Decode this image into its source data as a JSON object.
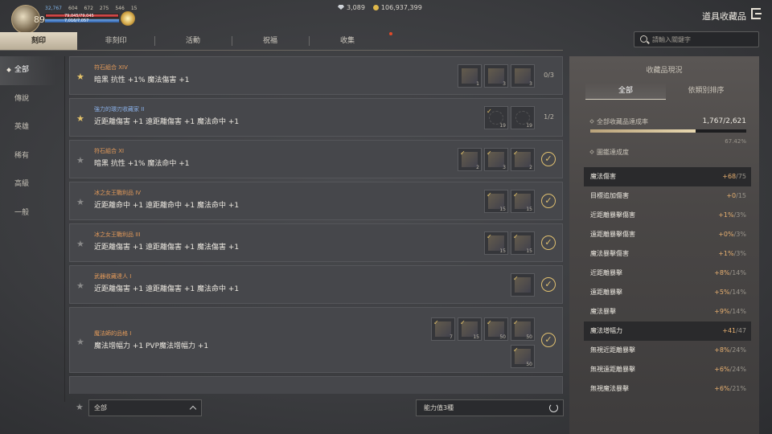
{
  "hud": {
    "level": "89",
    "stat1": "32,767",
    "stat2": "604",
    "stat3": "672",
    "stat4": "275",
    "stat5": "546",
    "stat6": "15",
    "hp": "79,045/79,045",
    "mp": "7,016/7,057"
  },
  "currency": {
    "gems": "3,089",
    "gold": "106,937,399"
  },
  "page_title": "道具收藏品",
  "tabs": [
    "刻印",
    "非刻印",
    "活動",
    "祝福",
    "收集"
  ],
  "search": {
    "placeholder": "請輸入關鍵字"
  },
  "sidebar": [
    "全部",
    "傳說",
    "英雄",
    "稀有",
    "高級",
    "一般"
  ],
  "rows": [
    {
      "category": "符石組合 XIV",
      "effect": "暗黑 抗性 +1% 魔法傷害 +1",
      "progress": "0/3",
      "star": "gold",
      "slots": [
        {
          "count": "1"
        },
        {
          "count": "3"
        },
        {
          "count": "3"
        }
      ]
    },
    {
      "category": "強力的環刃收藏家 II",
      "effect": "近距離傷害 +1 遠距離傷害 +1 魔法命中 +1",
      "progress": "1/2",
      "star": "gold",
      "slots": [
        {
          "count": "19",
          "empty": true,
          "chk": true
        },
        {
          "count": "19",
          "empty": true
        }
      ]
    },
    {
      "category": "符石組合 XI",
      "effect": "暗黑 抗性 +1% 魔法命中 +1",
      "progress": "",
      "star": "grey",
      "done": true,
      "slots": [
        {
          "count": "2",
          "chk": true
        },
        {
          "count": "3",
          "chk": true
        },
        {
          "count": "2",
          "chk": true
        }
      ]
    },
    {
      "category": "冰之女王戰利品 IV",
      "effect": "近距離命中 +1 遠距離命中 +1 魔法命中 +1",
      "progress": "",
      "star": "grey",
      "done": true,
      "slots": [
        {
          "count": "15",
          "chk": true
        },
        {
          "count": "15",
          "chk": true
        }
      ]
    },
    {
      "category": "冰之女王戰利品 III",
      "effect": "近距離傷害 +1 遠距離傷害 +1 魔法傷害 +1",
      "progress": "",
      "star": "grey",
      "done": true,
      "slots": [
        {
          "count": "15",
          "chk": true
        },
        {
          "count": "15",
          "chk": true
        }
      ]
    },
    {
      "category": "武器收藏達人 I",
      "effect": "近距離傷害 +1 遠距離傷害 +1 魔法命中 +1",
      "progress": "",
      "star": "grey",
      "done": true,
      "slots": [
        {
          "count": "",
          "chk": true
        }
      ]
    },
    {
      "category": "魔法師的品格 I",
      "effect": "魔法增幅力 +1 PVP魔法增幅力 +1",
      "progress": "",
      "star": "grey",
      "done": true,
      "slots": [
        {
          "count": "7",
          "chk": true
        },
        {
          "count": "15",
          "chk": true
        },
        {
          "count": "50",
          "chk": true
        },
        {
          "count": "50",
          "chk": true
        }
      ],
      "slots2": [
        {
          "count": "50",
          "chk": true
        }
      ]
    }
  ],
  "bottom": {
    "filter": "全部",
    "sort": "能力值3種"
  },
  "panel": {
    "title": "收藏品現況",
    "tab_all": "全部",
    "tab_sort": "依類別排序",
    "total_label": "全部收藏品達成率",
    "total_value": "1,767/2,621",
    "total_fraction": 0.6742,
    "total_pct": "67.42%",
    "collection_label": "圖鑑達成度",
    "stats": [
      {
        "name": "魔法傷害",
        "cur": "+68",
        "max": "/75",
        "hl": true
      },
      {
        "name": "目標追加傷害",
        "cur": "+0",
        "max": "/15"
      },
      {
        "name": "近距離暴擊傷害",
        "cur": "+1%",
        "max": "/3%"
      },
      {
        "name": "遠距離暴擊傷害",
        "cur": "+0%",
        "max": "/3%"
      },
      {
        "name": "魔法暴擊傷害",
        "cur": "+1%",
        "max": "/3%"
      },
      {
        "name": "近距離暴擊",
        "cur": "+8%",
        "max": "/14%"
      },
      {
        "name": "遠距離暴擊",
        "cur": "+5%",
        "max": "/14%"
      },
      {
        "name": "魔法暴擊",
        "cur": "+9%",
        "max": "/14%"
      },
      {
        "name": "魔法增幅力",
        "cur": "+41",
        "max": "/47",
        "hl": true
      },
      {
        "name": "無視近距離暴擊",
        "cur": "+8%",
        "max": "/24%"
      },
      {
        "name": "無視遠距離暴擊",
        "cur": "+6%",
        "max": "/24%"
      },
      {
        "name": "無視魔法暴擊",
        "cur": "+6%",
        "max": "/21%"
      }
    ]
  }
}
